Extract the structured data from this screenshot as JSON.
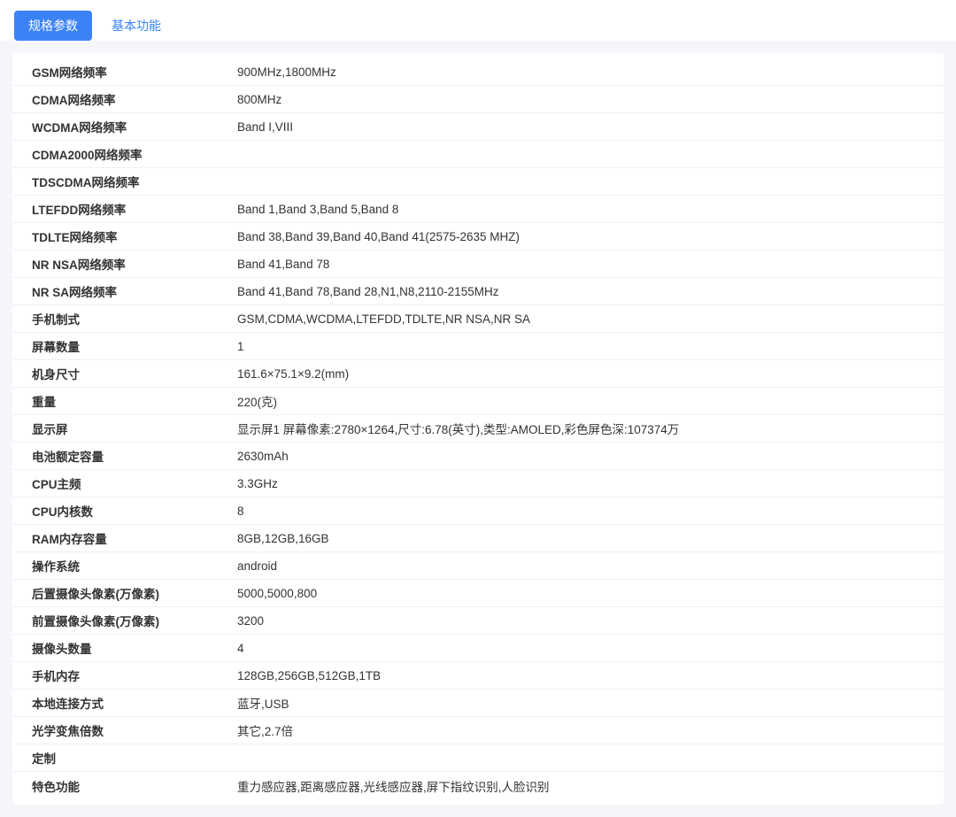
{
  "tabs": {
    "active": "规格参数",
    "inactive": "基本功能"
  },
  "specs": [
    {
      "label": "GSM网络频率",
      "value": "900MHz,1800MHz"
    },
    {
      "label": "CDMA网络频率",
      "value": "800MHz"
    },
    {
      "label": "WCDMA网络频率",
      "value": "Band I,VIII"
    },
    {
      "label": "CDMA2000网络频率",
      "value": ""
    },
    {
      "label": "TDSCDMA网络频率",
      "value": ""
    },
    {
      "label": "LTEFDD网络频率",
      "value": "Band 1,Band 3,Band 5,Band 8"
    },
    {
      "label": "TDLTE网络频率",
      "value": "Band 38,Band 39,Band 40,Band 41(2575-2635 MHZ)"
    },
    {
      "label": "NR NSA网络频率",
      "value": "Band 41,Band 78"
    },
    {
      "label": "NR SA网络频率",
      "value": "Band 41,Band 78,Band 28,N1,N8,2110-2155MHz"
    },
    {
      "label": "手机制式",
      "value": "GSM,CDMA,WCDMA,LTEFDD,TDLTE,NR NSA,NR SA"
    },
    {
      "label": "屏幕数量",
      "value": "1"
    },
    {
      "label": "机身尺寸",
      "value": "161.6×75.1×9.2(mm)"
    },
    {
      "label": "重量",
      "value": "220(克)"
    },
    {
      "label": "显示屏",
      "value": "显示屏1 屏幕像素:2780×1264,尺寸:6.78(英寸),类型:AMOLED,彩色屏色深:107374万"
    },
    {
      "label": "电池额定容量",
      "value": "2630mAh"
    },
    {
      "label": "CPU主频",
      "value": "3.3GHz"
    },
    {
      "label": "CPU内核数",
      "value": "8"
    },
    {
      "label": "RAM内存容量",
      "value": "8GB,12GB,16GB"
    },
    {
      "label": "操作系统",
      "value": "android"
    },
    {
      "label": "后置摄像头像素(万像素)",
      "value": "5000,5000,800"
    },
    {
      "label": "前置摄像头像素(万像素)",
      "value": "3200"
    },
    {
      "label": "摄像头数量",
      "value": "4"
    },
    {
      "label": "手机内存",
      "value": "128GB,256GB,512GB,1TB"
    },
    {
      "label": "本地连接方式",
      "value": "蓝牙,USB"
    },
    {
      "label": "光学变焦倍数",
      "value": "其它,2.7倍"
    },
    {
      "label": "定制",
      "value": ""
    },
    {
      "label": "特色功能",
      "value": "重力感应器,距离感应器,光线感应器,屏下指纹识别,人脸识别"
    }
  ]
}
